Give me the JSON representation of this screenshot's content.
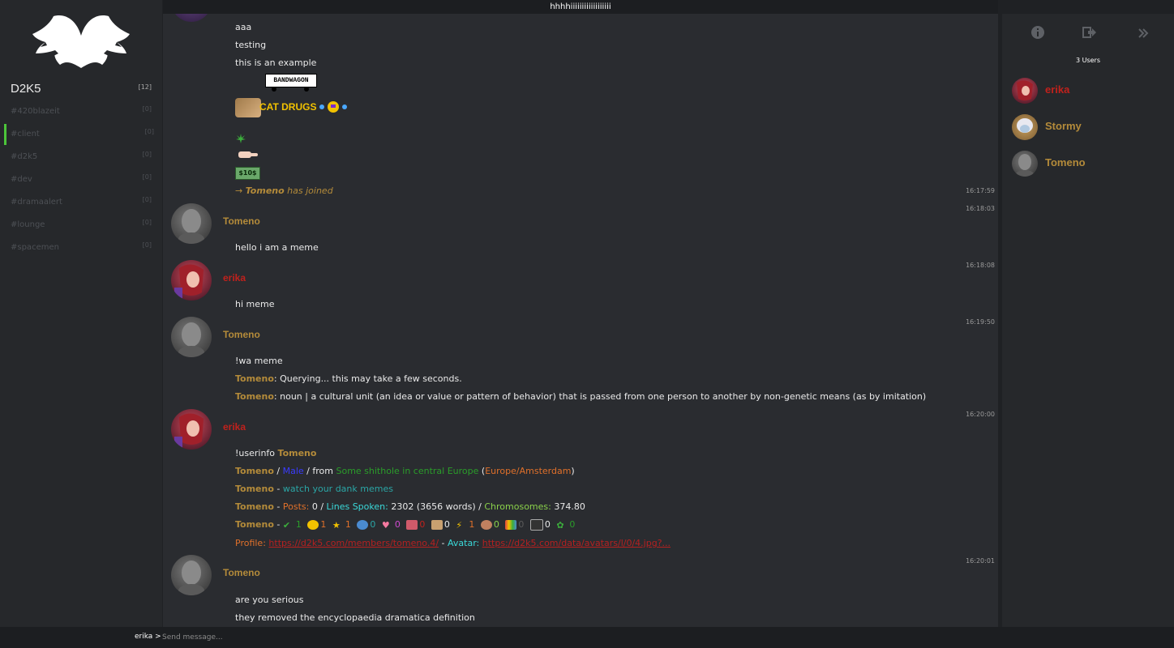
{
  "topic": "hhhhiiiiiiiiiiiiiiiiii",
  "server": {
    "name": "D2K5",
    "count": "[12]"
  },
  "channels": [
    {
      "name": "#420blazeit",
      "count": "[0]"
    },
    {
      "name": "#client",
      "count": "[0]"
    },
    {
      "name": "#d2k5",
      "count": "[0]"
    },
    {
      "name": "#dev",
      "count": "[0]"
    },
    {
      "name": "#dramaalert",
      "count": "[0]"
    },
    {
      "name": "#lounge",
      "count": "[0]"
    },
    {
      "name": "#spacemen",
      "count": "[0]"
    }
  ],
  "active_channel": "#client",
  "messages": {
    "pre": [
      "aaa",
      "testing",
      "this is an example"
    ],
    "bandwagon": "BANDWAGON",
    "catdrugs": "CAT DRUGS",
    "dollars": "$10$",
    "join": {
      "arrow": "→",
      "user": "Tomeno",
      "text": "has joined",
      "time": "16:17:59"
    },
    "m1": {
      "author": "Tomeno",
      "time": "16:18:03",
      "text": "hello i am a meme"
    },
    "m2": {
      "author": "erika",
      "time": "16:18:08",
      "text": "hi meme"
    },
    "m3": {
      "author": "Tomeno",
      "time": "16:19:50",
      "l1": "!wa meme",
      "l2_user": "Tomeno",
      "l2_text": ": Querying... this may take a few seconds.",
      "l3_user": "Tomeno",
      "l3_text": ": noun | a cultural unit (an idea or value or pattern of behavior) that is passed from one person to another by non-genetic means (as by imitation)"
    },
    "m4": {
      "author": "erika",
      "time": "16:20:00",
      "cmd": "!userinfo ",
      "cmd_user": "Tomeno",
      "info1_user": "Tomeno",
      "info1_sep": " / ",
      "info1_gender": "Male",
      "info1_from": " / from ",
      "info1_place": "Some shithole in central Europe",
      "info1_tz_open": " (",
      "info1_tz": "Europe/Amsterdam",
      "info1_tz_close": ")",
      "info2_user": "Tomeno",
      "info2_sep": " - ",
      "info2_text": "watch your dank memes",
      "info3_user": "Tomeno",
      "info3_sep": " - ",
      "posts_label": "Posts:",
      "posts_val": " 0 / ",
      "lines_label": "Lines Spoken:",
      "lines_val": " 2302 (3656 words) / ",
      "chromo_label": "Chromosomes:",
      "chromo_val": " 374.80",
      "info4_user": "Tomeno",
      "info4_sep": " - ",
      "badges": [
        "1",
        "1",
        "1",
        "0",
        "0",
        "0",
        "0",
        "1",
        "0",
        "0",
        "0",
        "0"
      ],
      "profile_label": "Profile:",
      "profile_url": "https://d2k5.com/members/tomeno.4/",
      "avatar_sep": " - ",
      "avatar_label": "Avatar:",
      "avatar_url": "https://d2k5.com/data/avatars/l/0/4.jpg?..."
    },
    "m5": {
      "author": "Tomeno",
      "time": "16:20:01",
      "l1": "are you serious",
      "l2": "they removed the encyclopaedia dramatica definition"
    }
  },
  "users": {
    "count_label": "3 Users",
    "list": [
      {
        "name": "erika"
      },
      {
        "name": "Stormy"
      },
      {
        "name": "Tomeno"
      }
    ]
  },
  "input": {
    "nick": "erika >",
    "placeholder": "Send message..."
  },
  "colors": {
    "tomeno": "#b48b3a",
    "erika": "#c0211c",
    "active": "#4cc53a"
  }
}
